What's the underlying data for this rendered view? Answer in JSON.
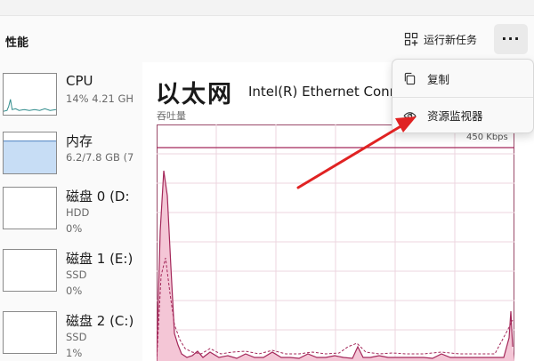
{
  "header": {
    "page_title": "性能",
    "run_task_label": "运行新任务",
    "more_label": "···"
  },
  "devices": [
    {
      "name": "CPU",
      "line1": "14%  4.21 GH",
      "line2": ""
    },
    {
      "name": "内存",
      "line1": "6.2/7.8 GB (7",
      "line2": ""
    },
    {
      "name": "磁盘 0 (D:",
      "line1": "HDD",
      "line2": "0%"
    },
    {
      "name": "磁盘 1 (E:)",
      "line1": "SSD",
      "line2": "0%"
    },
    {
      "name": "磁盘 2 (C:)",
      "line1": "SSD",
      "line2": "1%"
    }
  ],
  "main": {
    "title": "以太网",
    "subtitle": "Intel(R) Ethernet Conn",
    "axis_label": "吞吐量",
    "max_label": "450 Kbps"
  },
  "menu": {
    "items": [
      {
        "label": "复制",
        "icon": "copy-icon"
      },
      {
        "label": "资源监视器",
        "icon": "resource-monitor-icon"
      }
    ]
  },
  "colors": {
    "network_line": "#a4285a",
    "network_fill": "#f4c6d6",
    "cpu_line": "#2e8b8b",
    "memory_fill": "#c7ddf5",
    "memory_line": "#4a7fc1",
    "arrow": "#e02222"
  }
}
